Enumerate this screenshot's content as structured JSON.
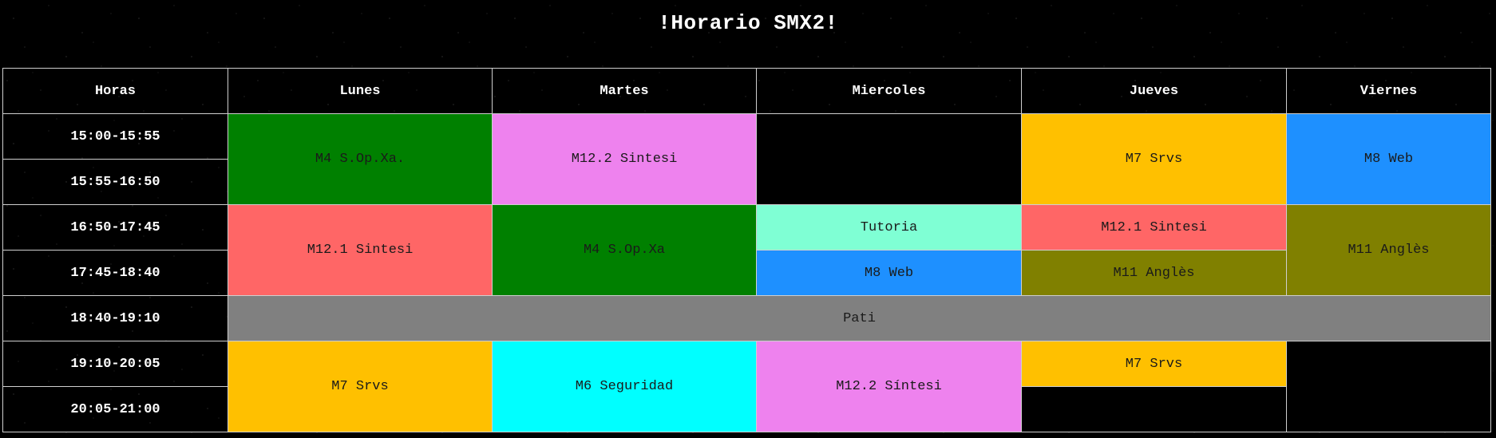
{
  "title": "!Horario SMX2!",
  "headers": [
    "Horas",
    "Lunes",
    "Martes",
    "Miercoles",
    "Jueves",
    "Viernes"
  ],
  "hours": [
    "15:00-15:55",
    "15:55-16:50",
    "16:50-17:45",
    "17:45-18:40",
    "18:40-19:10",
    "19:10-20:05",
    "20:05-21:00"
  ],
  "slots": {
    "lunes_1": {
      "label": "M4 S.Op.Xa.",
      "color": "#008000"
    },
    "martes_1": {
      "label": "M12.2 Sintesi",
      "color": "#EE82EE"
    },
    "miercoles_1": {
      "label": "",
      "color": "#000000"
    },
    "jueves_1": {
      "label": "M7 Srvs",
      "color": "#FFC000"
    },
    "viernes_1": {
      "label": "M8 Web",
      "color": "#1E90FF"
    },
    "lunes_2": {
      "label": "M12.1 Sintesi",
      "color": "#FF6666"
    },
    "martes_2": {
      "label": "M4 S.Op.Xa",
      "color": "#008000"
    },
    "miercoles_2a": {
      "label": "Tutoria",
      "color": "#7FFFD4"
    },
    "jueves_2a": {
      "label": "M12.1 Sintesi",
      "color": "#FF6666"
    },
    "viernes_2": {
      "label": "M11 Anglès",
      "color": "#808000"
    },
    "miercoles_2b": {
      "label": "M8 Web",
      "color": "#1E90FF"
    },
    "jueves_2b": {
      "label": "M11 Anglès",
      "color": "#808000"
    },
    "pati": {
      "label": "Pati",
      "color": "#808080"
    },
    "lunes_3": {
      "label": "M7 Srvs",
      "color": "#FFC000"
    },
    "martes_3": {
      "label": "M6 Seguridad",
      "color": "#00FFFF"
    },
    "miercoles_3": {
      "label": "M12.2 Síntesi",
      "color": "#EE82EE"
    },
    "jueves_3a": {
      "label": "M7 Srvs",
      "color": "#FFC000"
    },
    "viernes_3": {
      "label": "",
      "color": "#000000"
    },
    "jueves_3b": {
      "label": "",
      "color": "#000000"
    }
  }
}
